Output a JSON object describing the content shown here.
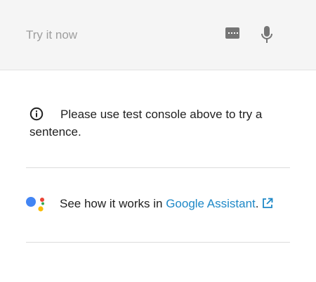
{
  "try_bar": {
    "placeholder": "Try it now",
    "keyboard_icon": "keyboard-icon",
    "mic_icon": "microphone-icon"
  },
  "info": {
    "icon": "info-icon",
    "text": "Please use test console above to try a sentence."
  },
  "assistant": {
    "logo": "google-assistant-logo",
    "prefix": "See how it works in ",
    "link_label": "Google Assistant",
    "suffix": ".",
    "external_icon": "external-link-icon"
  },
  "colors": {
    "link": "#1e88c7",
    "bar_bg": "#f5f5f5",
    "icon_gray": "#757575",
    "ga_blue": "#4285f4",
    "ga_red": "#ea4335",
    "ga_yellow": "#fbbc05",
    "ga_green": "#34a853"
  }
}
